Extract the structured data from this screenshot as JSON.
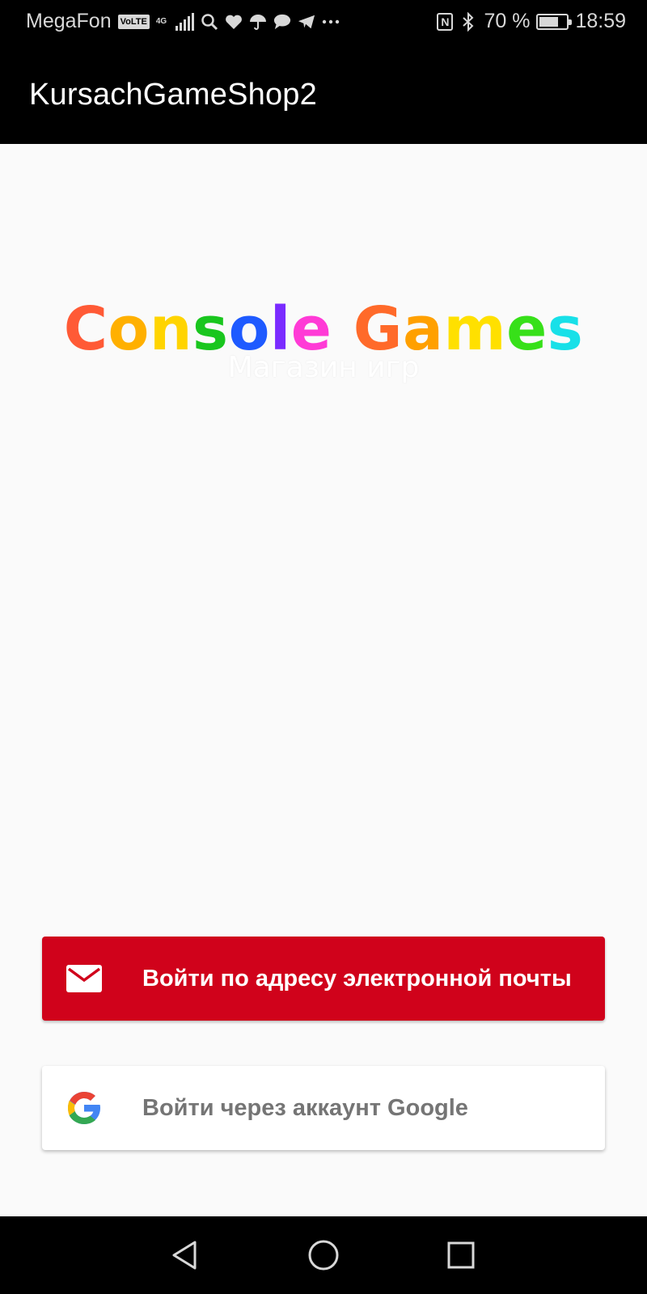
{
  "status_bar": {
    "carrier": "MegaFon",
    "volte_badge": "VoLTE",
    "network_type": "4G",
    "battery_text": "70 %",
    "battery_level": 0.7,
    "time": "18:59",
    "icons": [
      "volte-icon",
      "4g-icon",
      "signal-icon",
      "search-icon",
      "heart-icon",
      "umbrella-icon",
      "chat-icon",
      "telegram-icon",
      "more-icon",
      "nfc-icon",
      "bluetooth-icon",
      "battery-icon"
    ]
  },
  "app_bar": {
    "title": "KursachGameShop2"
  },
  "logo": {
    "letters": [
      {
        "ch": "C",
        "color": "#ff5a36"
      },
      {
        "ch": "o",
        "color": "#ffb000"
      },
      {
        "ch": "n",
        "color": "#ffd400"
      },
      {
        "ch": "s",
        "color": "#19c61e"
      },
      {
        "ch": "o",
        "color": "#1e5aff"
      },
      {
        "ch": "l",
        "color": "#7a2bff"
      },
      {
        "ch": "e",
        "color": "#ff3ad6"
      },
      {
        "ch": " ",
        "color": "#ffffff"
      },
      {
        "ch": "G",
        "color": "#ff6a2a"
      },
      {
        "ch": "a",
        "color": "#ffa000"
      },
      {
        "ch": "m",
        "color": "#ffe000"
      },
      {
        "ch": "e",
        "color": "#37e019"
      },
      {
        "ch": "s",
        "color": "#18e0e8"
      }
    ],
    "subtitle": "Магазин игр"
  },
  "buttons": {
    "email_label": "Войти по адресу электронной почты",
    "email_icon": "mail-icon",
    "email_color": "#d0021b",
    "google_label": "Войти через аккаунт Google",
    "google_icon": "google-icon"
  },
  "nav_bar": {
    "back_icon": "back-icon",
    "home_icon": "home-icon",
    "recents_icon": "recents-icon"
  }
}
